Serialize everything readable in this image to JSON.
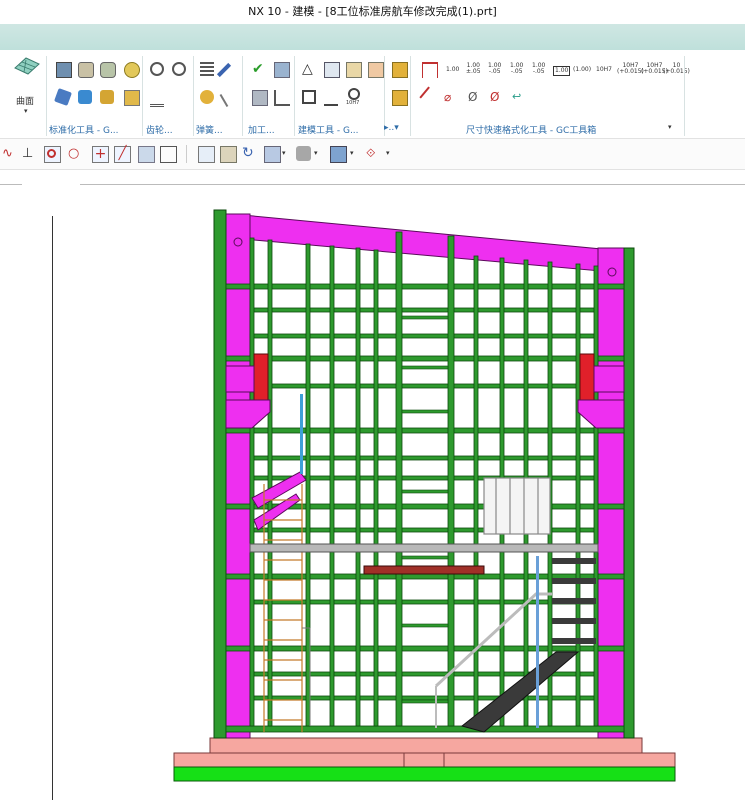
{
  "window": {
    "title": "NX 10 - 建模 - [8工位标准房航车修改完成(1).prt]"
  },
  "ribbon": {
    "surface_label": "曲面",
    "groups": [
      {
        "label": "标准化工具 - G...",
        "icon": "standard-tools-icon"
      },
      {
        "label": "齿轮...",
        "icon": "gear-tools-icon"
      },
      {
        "label": "弹簧...",
        "icon": "spring-tools-icon"
      },
      {
        "label": "加工...",
        "icon": "machining-tools-icon"
      },
      {
        "label": "建模工具 - G...",
        "icon": "modeling-tools-icon"
      },
      {
        "label": "尺寸快速格式化工具 - GC工具箱",
        "icon": "dimension-format-icon"
      }
    ],
    "dimension_buttons": {
      "plain": "1.00",
      "tol1_top": "1.00",
      "tol1_bottom": "±.05",
      "tol2_top": "1.00",
      "tol2_bottom": "-.05",
      "tol3_top": "1.00",
      "tol3_bottom": "-.05",
      "tol4_top": "1.00",
      "tol4_bottom": "-.05",
      "boxed": "1.00",
      "paren": "(1.00)",
      "fit": "10H7",
      "fit2_top": "10H7",
      "fit2_bottom": "(+0.015)",
      "fit3_top": "10H7",
      "fit3_bottom": "(+0.015)",
      "fit4_top": "10",
      "fit4_bottom": "(+0.015)",
      "hole_label": "10H7"
    }
  },
  "colors": {
    "frame_green": "#2e9a2e",
    "frame_outline": "#0c4a0c",
    "beam_magenta": "#ee2ff0",
    "red_block": "#e0202a",
    "base_pink": "#f6a7a0",
    "base_green": "#16e016",
    "accent_blue": "#2f6da8"
  }
}
